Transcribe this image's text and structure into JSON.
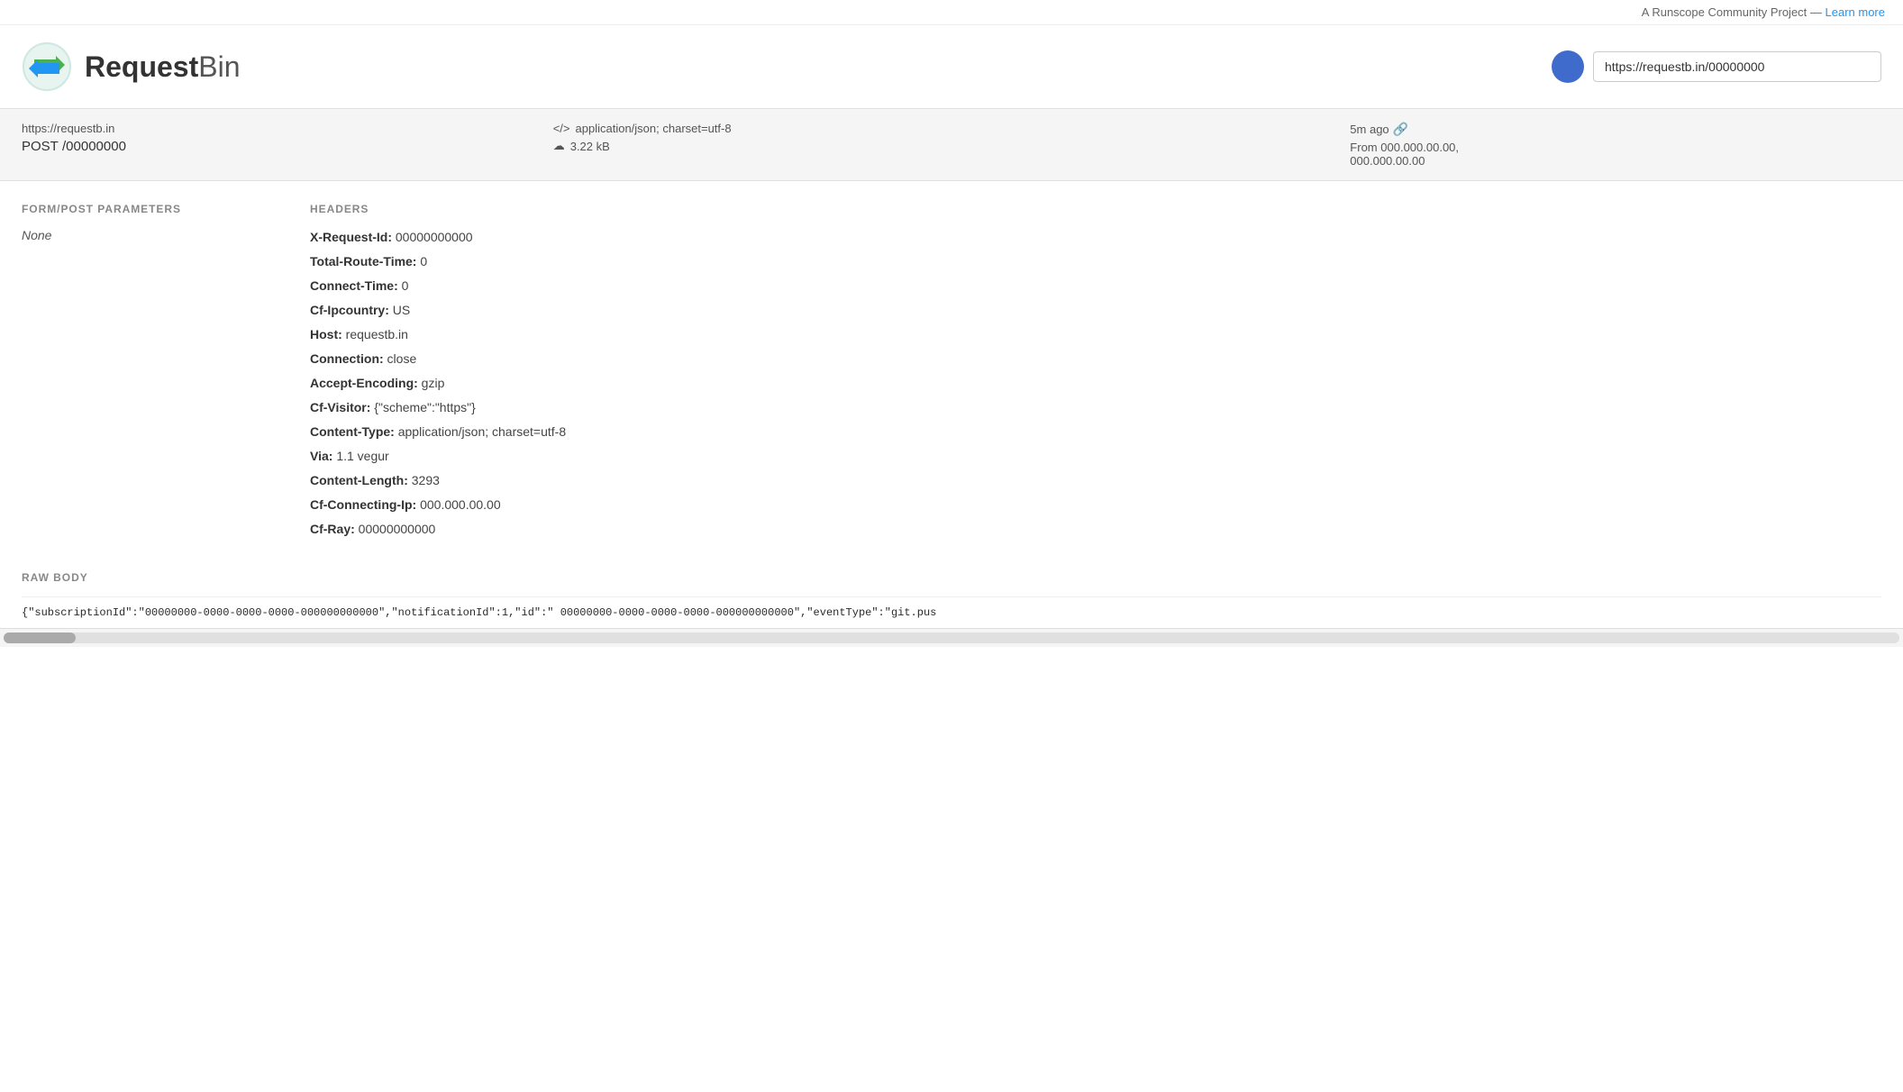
{
  "top_banner": {
    "text": "A Runscope Community Project — ",
    "link_label": "Learn more"
  },
  "header": {
    "logo_text_request": "Request",
    "logo_text_bin": "Bin",
    "url_value": "https://requestb.in/00000000"
  },
  "request_bar": {
    "url": "https://requestb.in",
    "method": "POST",
    "path": "/00000000",
    "content_type_icon": "</>",
    "content_type": "application/json; charset=utf-8",
    "size_icon": "☁",
    "size": "3.22 kB",
    "time_ago": "5m ago",
    "from_label": "From",
    "from_ip1": "000.000.00.00,",
    "from_ip2": "000.000.00.00"
  },
  "form_post": {
    "title": "FORM/POST PARAMETERS",
    "value": "None"
  },
  "headers": {
    "title": "HEADERS",
    "items": [
      {
        "key": "X-Request-Id:",
        "value": "00000000000"
      },
      {
        "key": "Total-Route-Time:",
        "value": "0"
      },
      {
        "key": "Connect-Time:",
        "value": "0"
      },
      {
        "key": "Cf-Ipcountry:",
        "value": "US"
      },
      {
        "key": "Host:",
        "value": "requestb.in"
      },
      {
        "key": "Connection:",
        "value": "close"
      },
      {
        "key": "Accept-Encoding:",
        "value": "gzip"
      },
      {
        "key": "Cf-Visitor:",
        "value": "{\"scheme\":\"https\"}"
      },
      {
        "key": "Content-Type:",
        "value": "application/json; charset=utf-8"
      },
      {
        "key": "Via:",
        "value": "1.1 vegur"
      },
      {
        "key": "Content-Length:",
        "value": "3293"
      },
      {
        "key": "Cf-Connecting-Ip:",
        "value": "000.000.00.00"
      },
      {
        "key": "Cf-Ray:",
        "value": "00000000000"
      }
    ]
  },
  "raw_body": {
    "title": "RAW BODY",
    "content": "{\"subscriptionId\":\"00000000-0000-0000-0000-000000000000\",\"notificationId\":1,\"id\":\" 00000000-0000-0000-0000-000000000000\",\"eventType\":\"git.pus"
  }
}
